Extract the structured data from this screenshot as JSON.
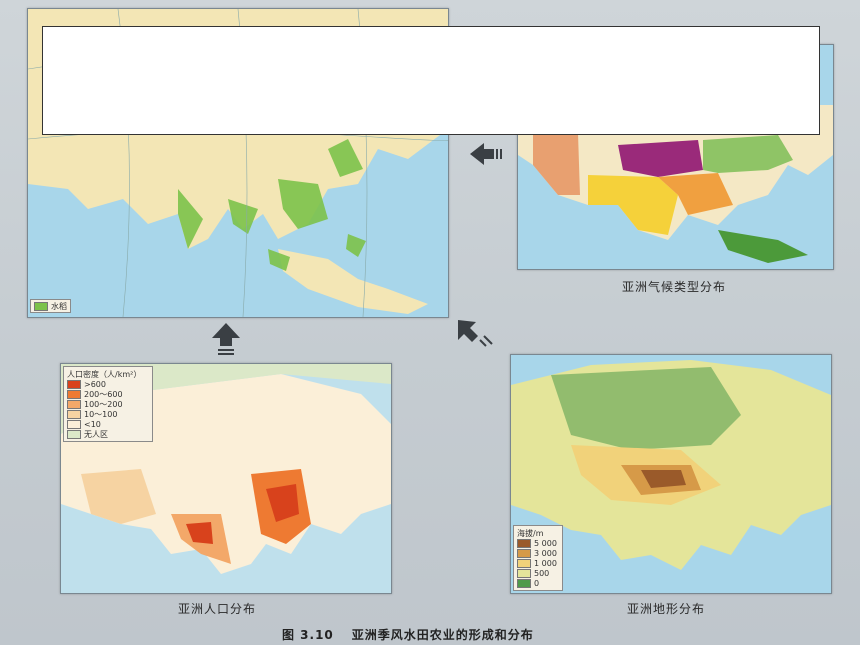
{
  "maps": {
    "rice": {
      "legend_label": "水稻",
      "colors": {
        "rice": "#7cc24a",
        "land": "#f3e6b5",
        "sea": "#a8d6ea"
      }
    },
    "climate": {
      "caption": "亚洲气候类型分布",
      "colors": {
        "desert": "#e8a070",
        "plateau": "#9a2a7a",
        "monsoon_trop": "#f5d13a",
        "monsoon_sub": "#f0a040",
        "temperate": "#8fc466",
        "rainforest": "#4c9a3a"
      }
    },
    "population": {
      "caption": "亚洲人口分布",
      "legend_title": "人口密度（人/km²）",
      "legend_items": [
        {
          "label": ">600",
          "color": "#d8421c"
        },
        {
          "label": "200～600",
          "color": "#ee7a32"
        },
        {
          "label": "100～200",
          "color": "#f3a869"
        },
        {
          "label": "10～100",
          "color": "#f6d3a2"
        },
        {
          "label": "<10",
          "color": "#fbefd8"
        },
        {
          "label": "无人区",
          "color": "#dbe8c8"
        }
      ]
    },
    "terrain": {
      "caption": "亚洲地形分布",
      "legend_title": "海拔/m",
      "legend_items": [
        {
          "label": "5 000",
          "color": "#9a5a2a"
        },
        {
          "label": "3 000",
          "color": "#d69a48"
        },
        {
          "label": "1 000",
          "color": "#f1d27a"
        },
        {
          "label": "500",
          "color": "#e4e59a"
        },
        {
          "label": "0",
          "color": "#4f9a4a"
        }
      ]
    }
  },
  "figure": {
    "number": "图 3.10",
    "title": "亚洲季风水田农业的形成和分布"
  }
}
